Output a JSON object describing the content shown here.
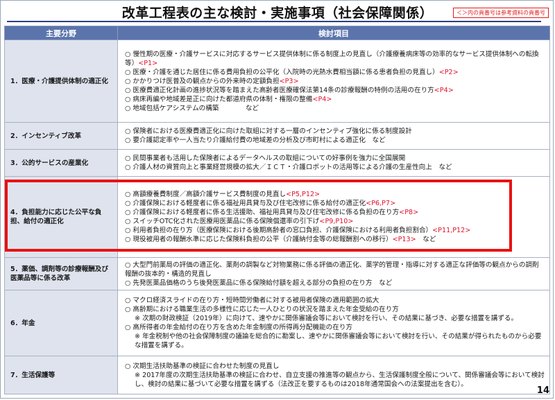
{
  "title": "改革工程表の主な検討・実施事項（社会保障関係）",
  "note": "＜＞内の頁番号は参考資料の頁番号",
  "header": {
    "category": "主要分野",
    "items": "検討項目"
  },
  "sections": [
    {
      "category": "1．医療・介護提供体制の適正化",
      "items": [
        {
          "text": "○ 慢性期の医療・介護サービスに対応するサービス提供体制に係る制度上の見直し（介護療養病床等の効率的なサービス提供体制への転換等）",
          "ref": "<P1>"
        },
        {
          "text": "○ 医療・介護を通じた居住に係る費用負担の公平化（入院時の光熱水費相当額に係る患者負担の見直し）",
          "ref": "<P2>"
        },
        {
          "text": "○ かかりつけ医普及の観点からの外来時の定額負担",
          "ref": "<P3>"
        },
        {
          "text": "○ 医療費適正化計画の進捗状況等を踏まえた高齢者医療確保法第14条の診療報酬の特例の活用の在り方",
          "ref": "<P4>"
        },
        {
          "text": "○ 病床再編や地域差是正に向けた都道府県の体制・権限の整備",
          "ref": "<P4>"
        },
        {
          "text": "○ 地域包括ケアシステムの構築　　　　など",
          "ref": ""
        }
      ]
    },
    {
      "category": "2．インセンティブ改革",
      "items": [
        {
          "text": "○ 保険者における医療費適正化に向けた取組に対する一層のインセンティブ強化に係る制度設計",
          "ref": ""
        },
        {
          "text": "○ 要介護認定率や一人当たり介護給付費の地域差の分析及び市町村による適正化　など",
          "ref": ""
        }
      ]
    },
    {
      "category": "3．公的サービスの産業化",
      "items": [
        {
          "text": "○ 民間事業者も活用した保険者によるデータヘルスの取組についての好事例を強力に全国展開",
          "ref": ""
        },
        {
          "text": "○ 介護人材の資質向上と事業経営規模の拡大／ＩＣＴ・介護ロボットの活用等による介護の生産性向上　など",
          "ref": ""
        }
      ]
    },
    {
      "category": "4．負担能力に応じた公平な負担、給付の適正化",
      "items": [
        {
          "text": "○ 高額療養費制度／高額介護サービス費制度の見直し",
          "ref": "<P5,P12>"
        },
        {
          "text": "○ 介護保険における軽度者に係る福祉用具貸与及び住宅改修に係る給付の適正化",
          "ref": "<P6,P7>"
        },
        {
          "text": "○ 介護保険における軽度者に係る生活援助、福祉用具貸与及び住宅改修に係る負担の在り方",
          "ref": "<P8>"
        },
        {
          "text": "○ スイッチOTC化された医療用医薬品に係る保険償還率の引下げ",
          "ref": "<P9,P10>"
        },
        {
          "text": "○ 利用者負担の在り方（医療保険における後期高齢者の窓口負担、介護保険における利用者負担割合）",
          "ref": "<P11,P12>"
        },
        {
          "text": "○ 現役被用者の報酬水準に応じた保険料負担の公平（介護納付金等の総報酬割への移行）",
          "ref": "<P13>",
          "tail": "　など"
        }
      ]
    },
    {
      "category": "5．薬価、調剤等の診療報酬及び医薬品等に係る改革",
      "items": [
        {
          "text": "○ 大型門前薬局の評価の適正化、薬剤の調製など対物業務に係る評価の適正化、薬学的管理・指導に対する適正な評価等の観点からの調剤報酬の抜本的・構造的見直し",
          "ref": ""
        },
        {
          "text": "○ 先発医薬品価格のうち後発医薬品に係る保険給付額を超える部分の負担の在り方　など",
          "ref": ""
        }
      ]
    },
    {
      "category": "6．年金",
      "items": [
        {
          "text": "○ マクロ経済スライドの在り方・短時間労働者に対する被用者保険の適用範囲の拡大",
          "ref": ""
        },
        {
          "text": "○ 高齢期における職業生活の多様性に応じた一人ひとりの状況を踏まえた年金受給の在り方",
          "ref": ""
        },
        {
          "text": "※ 次期の財政検証（2019年）に向けて、速やかに関係審議会等において検討を行い、その結果に基づき、必要な措置を講ずる。",
          "ref": "",
          "sub": true
        },
        {
          "text": "○ 高所得者の年金給付の在り方を含めた年金制度の所得再分配機能の在り方",
          "ref": ""
        },
        {
          "text": "※ 年金税制や他の社会保障制度の議論を総合的に勘案し、速やかに関係審議会等において検討を行い、その結果が得られたものから必要な措置を講ずる。",
          "ref": "",
          "sub": true
        }
      ]
    },
    {
      "category": "7．生活保護等",
      "items": [
        {
          "text": "○ 次期生活扶助基準の検証に合わせた制度の見直し",
          "ref": ""
        },
        {
          "text": "※ 2017年度の次期生活扶助基準の検証に合わせ、自立支援の推進等の観点から、生活保護制度全般について、関係審議会等において検討し、検討の結果に基づいて必要な措置を講ずる（法改正を要するものは2018年通常国会への法案提出を含む）。",
          "ref": "",
          "sub": true
        }
      ]
    }
  ],
  "page_number": "14",
  "colors": {
    "header_bg": "#5b74ac",
    "category_bg": "#dee3ee",
    "reference": "#e0102a",
    "highlight_border": "#ea1111",
    "title_rule": "#2b3f80"
  }
}
